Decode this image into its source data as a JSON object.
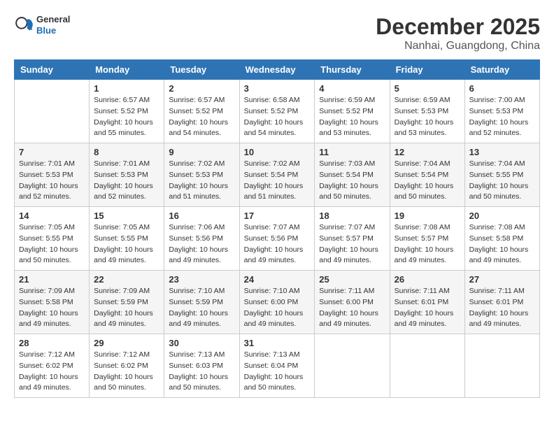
{
  "header": {
    "logo_general": "General",
    "logo_blue": "Blue",
    "month": "December 2025",
    "location": "Nanhai, Guangdong, China"
  },
  "weekdays": [
    "Sunday",
    "Monday",
    "Tuesday",
    "Wednesday",
    "Thursday",
    "Friday",
    "Saturday"
  ],
  "weeks": [
    [
      {
        "day": "",
        "info": ""
      },
      {
        "day": "1",
        "info": "Sunrise: 6:57 AM\nSunset: 5:52 PM\nDaylight: 10 hours\nand 55 minutes."
      },
      {
        "day": "2",
        "info": "Sunrise: 6:57 AM\nSunset: 5:52 PM\nDaylight: 10 hours\nand 54 minutes."
      },
      {
        "day": "3",
        "info": "Sunrise: 6:58 AM\nSunset: 5:52 PM\nDaylight: 10 hours\nand 54 minutes."
      },
      {
        "day": "4",
        "info": "Sunrise: 6:59 AM\nSunset: 5:52 PM\nDaylight: 10 hours\nand 53 minutes."
      },
      {
        "day": "5",
        "info": "Sunrise: 6:59 AM\nSunset: 5:53 PM\nDaylight: 10 hours\nand 53 minutes."
      },
      {
        "day": "6",
        "info": "Sunrise: 7:00 AM\nSunset: 5:53 PM\nDaylight: 10 hours\nand 52 minutes."
      }
    ],
    [
      {
        "day": "7",
        "info": "Sunrise: 7:01 AM\nSunset: 5:53 PM\nDaylight: 10 hours\nand 52 minutes."
      },
      {
        "day": "8",
        "info": "Sunrise: 7:01 AM\nSunset: 5:53 PM\nDaylight: 10 hours\nand 52 minutes."
      },
      {
        "day": "9",
        "info": "Sunrise: 7:02 AM\nSunset: 5:53 PM\nDaylight: 10 hours\nand 51 minutes."
      },
      {
        "day": "10",
        "info": "Sunrise: 7:02 AM\nSunset: 5:54 PM\nDaylight: 10 hours\nand 51 minutes."
      },
      {
        "day": "11",
        "info": "Sunrise: 7:03 AM\nSunset: 5:54 PM\nDaylight: 10 hours\nand 50 minutes."
      },
      {
        "day": "12",
        "info": "Sunrise: 7:04 AM\nSunset: 5:54 PM\nDaylight: 10 hours\nand 50 minutes."
      },
      {
        "day": "13",
        "info": "Sunrise: 7:04 AM\nSunset: 5:55 PM\nDaylight: 10 hours\nand 50 minutes."
      }
    ],
    [
      {
        "day": "14",
        "info": "Sunrise: 7:05 AM\nSunset: 5:55 PM\nDaylight: 10 hours\nand 50 minutes."
      },
      {
        "day": "15",
        "info": "Sunrise: 7:05 AM\nSunset: 5:55 PM\nDaylight: 10 hours\nand 49 minutes."
      },
      {
        "day": "16",
        "info": "Sunrise: 7:06 AM\nSunset: 5:56 PM\nDaylight: 10 hours\nand 49 minutes."
      },
      {
        "day": "17",
        "info": "Sunrise: 7:07 AM\nSunset: 5:56 PM\nDaylight: 10 hours\nand 49 minutes."
      },
      {
        "day": "18",
        "info": "Sunrise: 7:07 AM\nSunset: 5:57 PM\nDaylight: 10 hours\nand 49 minutes."
      },
      {
        "day": "19",
        "info": "Sunrise: 7:08 AM\nSunset: 5:57 PM\nDaylight: 10 hours\nand 49 minutes."
      },
      {
        "day": "20",
        "info": "Sunrise: 7:08 AM\nSunset: 5:58 PM\nDaylight: 10 hours\nand 49 minutes."
      }
    ],
    [
      {
        "day": "21",
        "info": "Sunrise: 7:09 AM\nSunset: 5:58 PM\nDaylight: 10 hours\nand 49 minutes."
      },
      {
        "day": "22",
        "info": "Sunrise: 7:09 AM\nSunset: 5:59 PM\nDaylight: 10 hours\nand 49 minutes."
      },
      {
        "day": "23",
        "info": "Sunrise: 7:10 AM\nSunset: 5:59 PM\nDaylight: 10 hours\nand 49 minutes."
      },
      {
        "day": "24",
        "info": "Sunrise: 7:10 AM\nSunset: 6:00 PM\nDaylight: 10 hours\nand 49 minutes."
      },
      {
        "day": "25",
        "info": "Sunrise: 7:11 AM\nSunset: 6:00 PM\nDaylight: 10 hours\nand 49 minutes."
      },
      {
        "day": "26",
        "info": "Sunrise: 7:11 AM\nSunset: 6:01 PM\nDaylight: 10 hours\nand 49 minutes."
      },
      {
        "day": "27",
        "info": "Sunrise: 7:11 AM\nSunset: 6:01 PM\nDaylight: 10 hours\nand 49 minutes."
      }
    ],
    [
      {
        "day": "28",
        "info": "Sunrise: 7:12 AM\nSunset: 6:02 PM\nDaylight: 10 hours\nand 49 minutes."
      },
      {
        "day": "29",
        "info": "Sunrise: 7:12 AM\nSunset: 6:02 PM\nDaylight: 10 hours\nand 50 minutes."
      },
      {
        "day": "30",
        "info": "Sunrise: 7:13 AM\nSunset: 6:03 PM\nDaylight: 10 hours\nand 50 minutes."
      },
      {
        "day": "31",
        "info": "Sunrise: 7:13 AM\nSunset: 6:04 PM\nDaylight: 10 hours\nand 50 minutes."
      },
      {
        "day": "",
        "info": ""
      },
      {
        "day": "",
        "info": ""
      },
      {
        "day": "",
        "info": ""
      }
    ]
  ]
}
